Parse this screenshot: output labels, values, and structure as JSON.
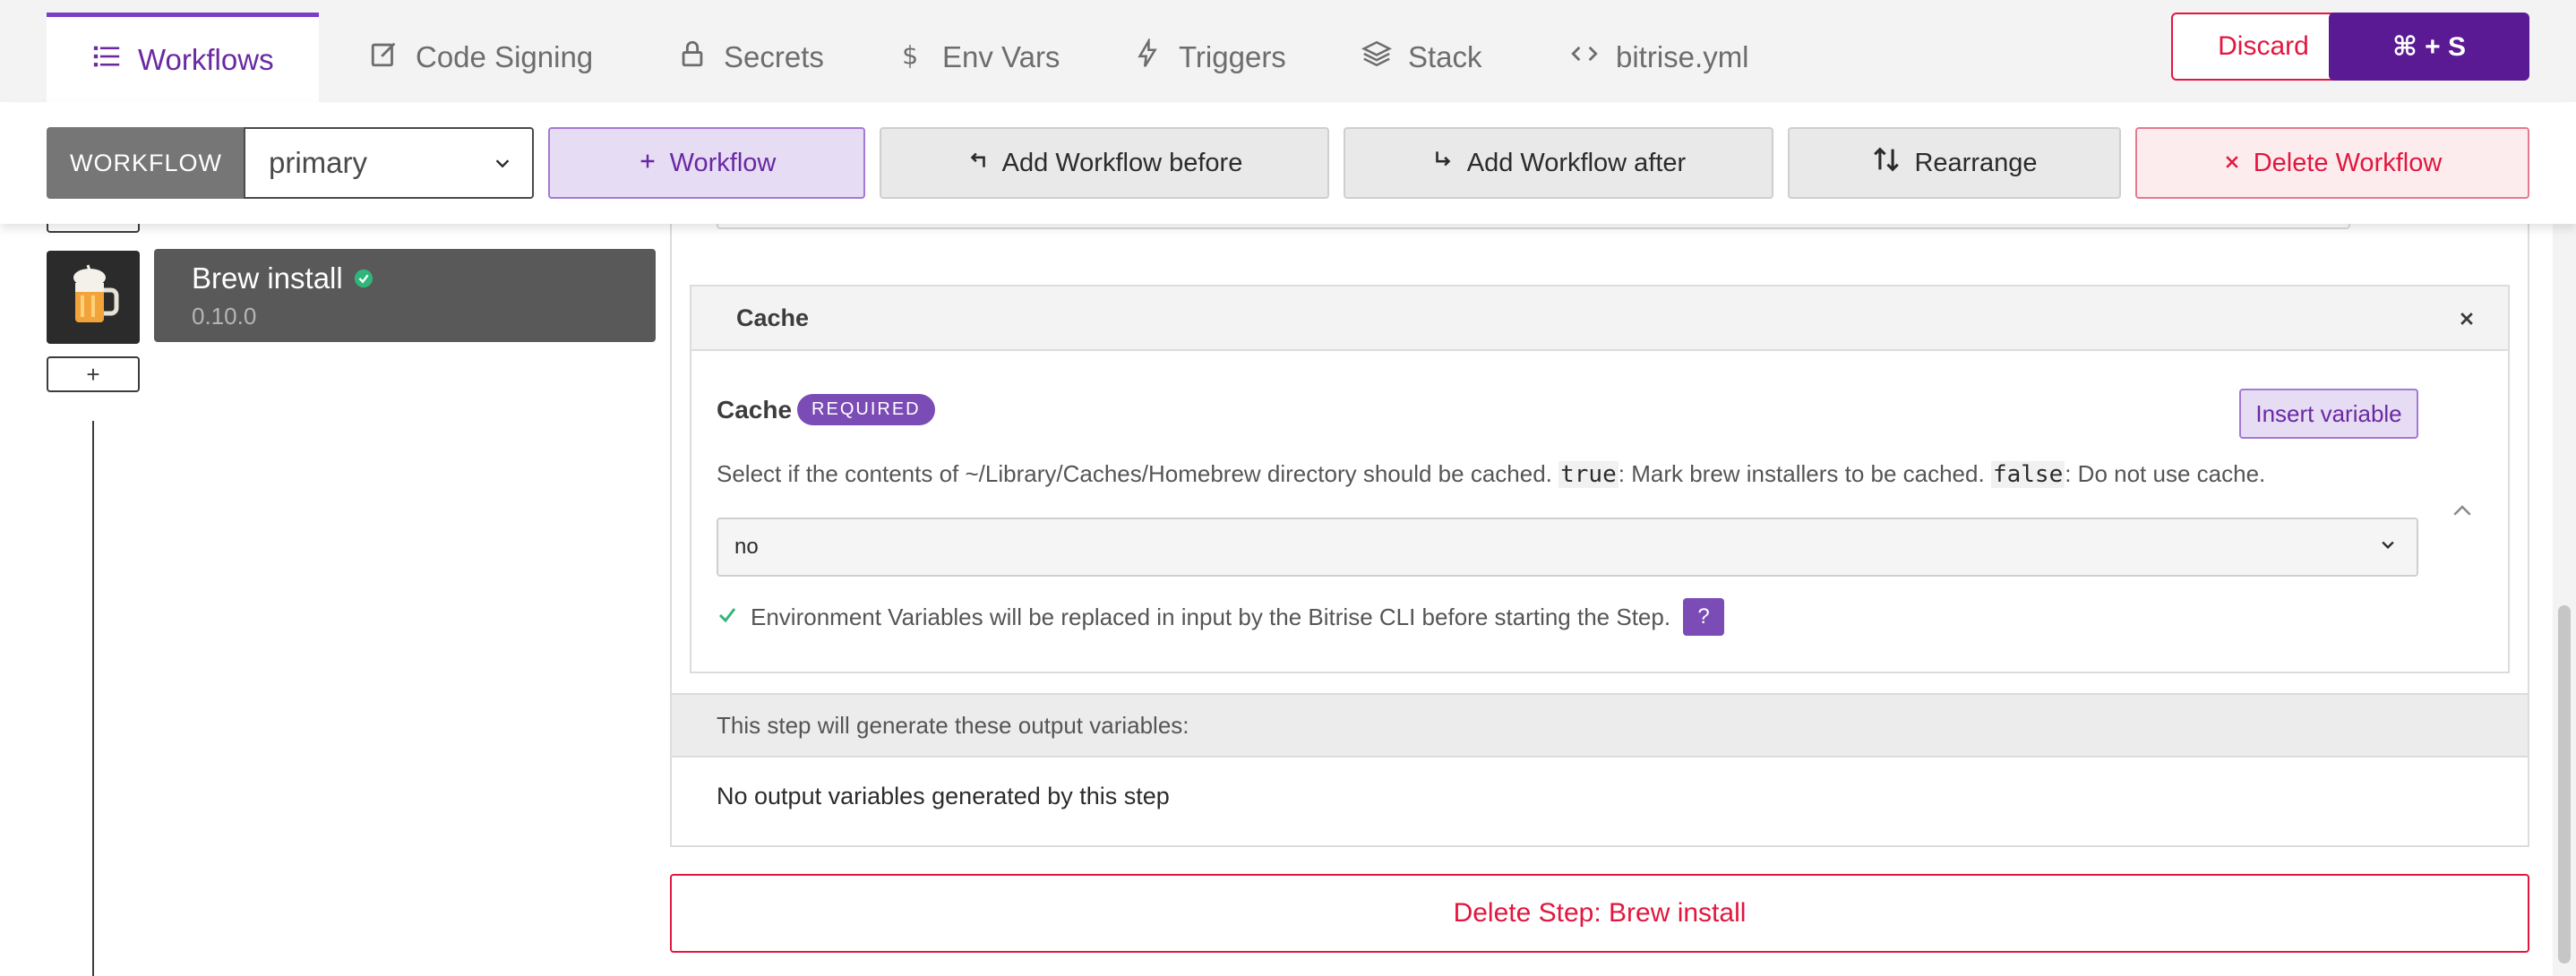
{
  "tabs": [
    {
      "label": "Workflows",
      "icon": "list-icon",
      "active": true
    },
    {
      "label": "Code Signing",
      "icon": "code-signing-icon",
      "active": false
    },
    {
      "label": "Secrets",
      "icon": "lock-icon",
      "active": false
    },
    {
      "label": "Env Vars",
      "icon": "dollar-icon",
      "active": false
    },
    {
      "label": "Triggers",
      "icon": "bolt-icon",
      "active": false
    },
    {
      "label": "Stack",
      "icon": "stack-icon",
      "active": false
    },
    {
      "label": "bitrise.yml",
      "icon": "code-icon",
      "active": false
    }
  ],
  "header_actions": {
    "discard": "Discard",
    "save": "⌘ + S"
  },
  "toolbar": {
    "workflow_tag": "WORKFLOW",
    "workflow_selected": "primary",
    "add_workflow": "Workflow",
    "add_before": "Add Workflow before",
    "add_after": "Add Workflow after",
    "rearrange": "Rearrange",
    "delete_workflow": "Delete Workflow"
  },
  "steps": [
    {
      "title": "Brew install",
      "version": "0.10.0",
      "status": "success"
    }
  ],
  "add_step_label": "+",
  "inputs_section": {
    "title": "Cache",
    "input": {
      "title": "Cache",
      "badge": "REQUIRED",
      "insert_variable": "Insert variable",
      "desc_part1": "Select if the contents of ~/Library/Caches/Homebrew directory should be cached.",
      "desc_code1": "true",
      "desc_part2": ": Mark brew installers to be cached.",
      "desc_code2": "false",
      "desc_part3": ": Do not use cache.",
      "value": "no",
      "env_note": "Environment Variables will be replaced in input by the Bitrise CLI before starting the Step.",
      "help": "?"
    }
  },
  "outputs": {
    "header": "This step will generate these output variables:",
    "empty": "No output variables generated by this step"
  },
  "delete_step": "Delete Step: Brew install",
  "colors": {
    "brand_purple": "#6a29a3",
    "save_bg": "#5a1a94",
    "danger": "#e1173f",
    "success": "#2fb67b"
  }
}
